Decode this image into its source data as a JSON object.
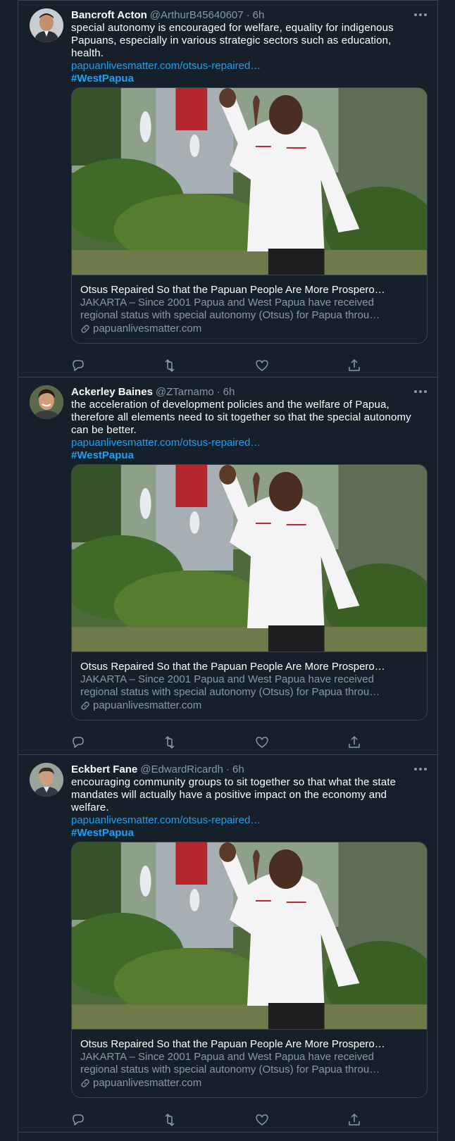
{
  "tweets": [
    {
      "name": "Bancroft Acton",
      "handle": "@ArthurB45640607",
      "time": "6h",
      "text": "special autonomy is encouraged for welfare, equality for indigenous Papuans, especially in various strategic sectors such as education, health.",
      "link": "papuanlivesmatter.com/otsus-repaired…",
      "hashtag": "#WestPapua",
      "avatar_icon": "man-in-suit-avatar",
      "card": {
        "title": "Otsus Repaired So that the Papuan People Are More Prospero…",
        "desc_line1": "JAKARTA – Since 2001 Papua and West Papua have received",
        "desc_line2": "regional status with special autonomy (Otsus) for Papua throu…",
        "domain": "papuanlivesmatter.com"
      }
    },
    {
      "name": "Ackerley Baines",
      "handle": "@ZTarnamo",
      "time": "6h",
      "text": "the acceleration of development policies and the welfare of Papua, therefore all elements need to sit together so that the special autonomy can be better.",
      "link": "papuanlivesmatter.com/otsus-repaired…",
      "hashtag": "#WestPapua",
      "avatar_icon": "smiling-man-avatar",
      "card": {
        "title": "Otsus Repaired So that the Papuan People Are More Prospero…",
        "desc_line1": "JAKARTA – Since 2001 Papua and West Papua have received",
        "desc_line2": "regional status with special autonomy (Otsus) for Papua throu…",
        "domain": "papuanlivesmatter.com"
      }
    },
    {
      "name": "Eckbert Fane",
      "handle": "@EdwardRicardh",
      "time": "6h",
      "text": "encouraging community groups to sit together so that what the state mandates will actually have a positive impact on the economy and welfare.",
      "link": "papuanlivesmatter.com/otsus-repaired…",
      "hashtag": "#WestPapua",
      "avatar_icon": "man-portrait-avatar",
      "card": {
        "title": "Otsus Repaired So that the Papuan People Are More Prospero…",
        "desc_line1": "JAKARTA – Since 2001 Papua and West Papua have received",
        "desc_line2": "regional status with special autonomy (Otsus) for Papua throu…",
        "domain": "papuanlivesmatter.com"
      }
    }
  ],
  "icons": {
    "more": "more-horizontal-icon",
    "reply": "reply-icon",
    "retweet": "retweet-icon",
    "like": "heart-icon",
    "share": "share-icon",
    "link": "link-icon"
  },
  "colors": {
    "background": "#15202b",
    "border": "#38444d",
    "accent": "#1da1f2",
    "secondary_text": "#8899a6"
  }
}
